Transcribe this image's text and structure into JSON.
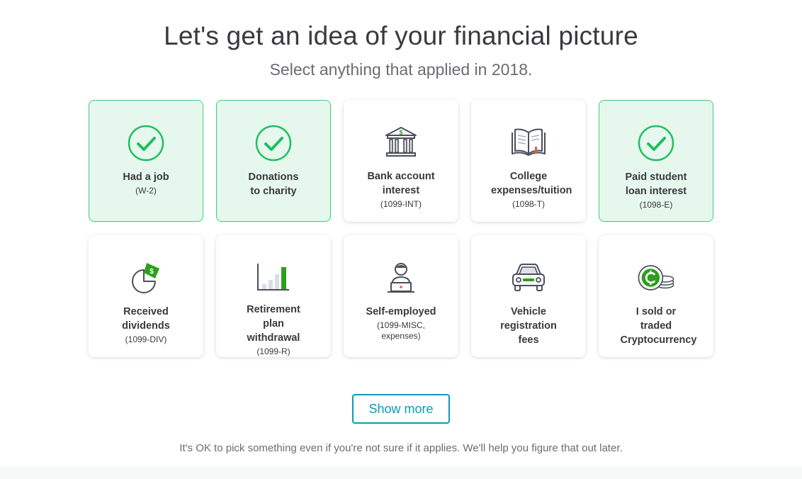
{
  "header": {
    "title": "Let's get an idea of your financial picture",
    "subtitle": "Select anything that applied in 2018."
  },
  "cards": [
    {
      "label": "Had a job",
      "sub": "(W-2)",
      "icon": "checkmark-icon",
      "selected": true
    },
    {
      "label": "Donations to charity",
      "sub": "",
      "icon": "checkmark-icon",
      "selected": true
    },
    {
      "label": "Bank account interest",
      "sub": "(1099-INT)",
      "icon": "bank-icon",
      "selected": false
    },
    {
      "label": "College expenses/tuition",
      "sub": "(1098-T)",
      "icon": "book-icon",
      "selected": false
    },
    {
      "label": "Paid student loan interest",
      "sub": "(1098-E)",
      "icon": "checkmark-icon",
      "selected": true
    },
    {
      "label": "Received dividends",
      "sub": "(1099-DIV)",
      "icon": "pie-chart-icon",
      "selected": false
    },
    {
      "label": "Retirement plan withdrawal",
      "sub": "(1099-R)",
      "icon": "bar-chart-icon",
      "selected": false
    },
    {
      "label": "Self-employed",
      "sub": "(1099-MISC, expenses)",
      "icon": "person-laptop-icon",
      "selected": false
    },
    {
      "label": "Vehicle registration fees",
      "sub": "",
      "icon": "car-icon",
      "selected": false
    },
    {
      "label": "I sold or traded Cryptocurrency",
      "sub": "",
      "icon": "crypto-coin-icon",
      "selected": false
    }
  ],
  "actions": {
    "show_more": "Show more"
  },
  "footer": {
    "note": "It's OK to pick something even if you're not sure if it applies. We'll help you figure that out later."
  },
  "colors": {
    "accent_green": "#2ca01c",
    "check_green": "#1fbf5f",
    "selected_bg": "#e6f8ee",
    "teal": "#0d9bb3",
    "text": "#393a3d"
  }
}
